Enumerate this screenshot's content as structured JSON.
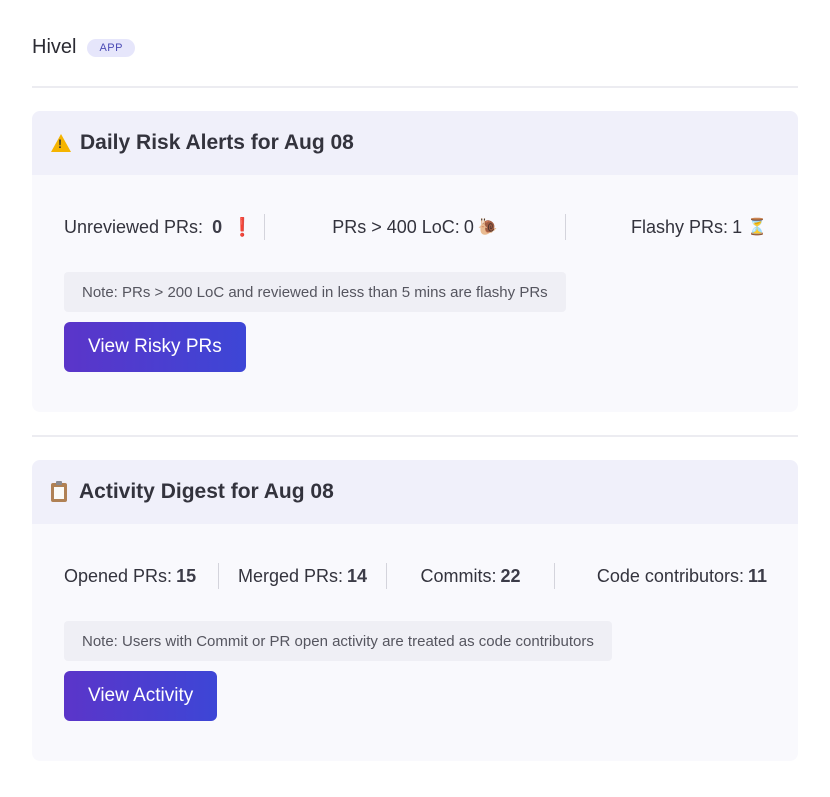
{
  "app": {
    "name": "Hivel",
    "badge": "APP"
  },
  "risk": {
    "title": "Daily Risk Alerts for Aug 08",
    "stats": [
      {
        "label": "Unreviewed PRs:",
        "value": "0",
        "icon": "exclamation-icon",
        "glyph": "❗"
      },
      {
        "label": "PRs > 400 LoC:",
        "value": "0",
        "icon": "snail-icon",
        "glyph": "🐌"
      },
      {
        "label": "Flashy PRs:",
        "value": "1",
        "icon": "hourglass-icon",
        "glyph": "⏳"
      }
    ],
    "note": "Note: PRs > 200 LoC and reviewed in less than 5 mins are flashy PRs",
    "button": "View Risky PRs"
  },
  "activity": {
    "title": "Activity Digest for Aug 08",
    "stats": [
      {
        "label": "Opened PRs:",
        "value": "15"
      },
      {
        "label": "Merged PRs:",
        "value": "14"
      },
      {
        "label": "Commits:",
        "value": "22"
      },
      {
        "label": "Code contributors:",
        "value": "11"
      }
    ],
    "note": "Note: Users with Commit or PR open activity are treated as code contributors",
    "button": "View Activity"
  },
  "colors": {
    "accent_start": "#5b35c9",
    "accent_end": "#3d46d6",
    "alert_red": "#e02020",
    "warning_yellow": "#f5b400"
  }
}
